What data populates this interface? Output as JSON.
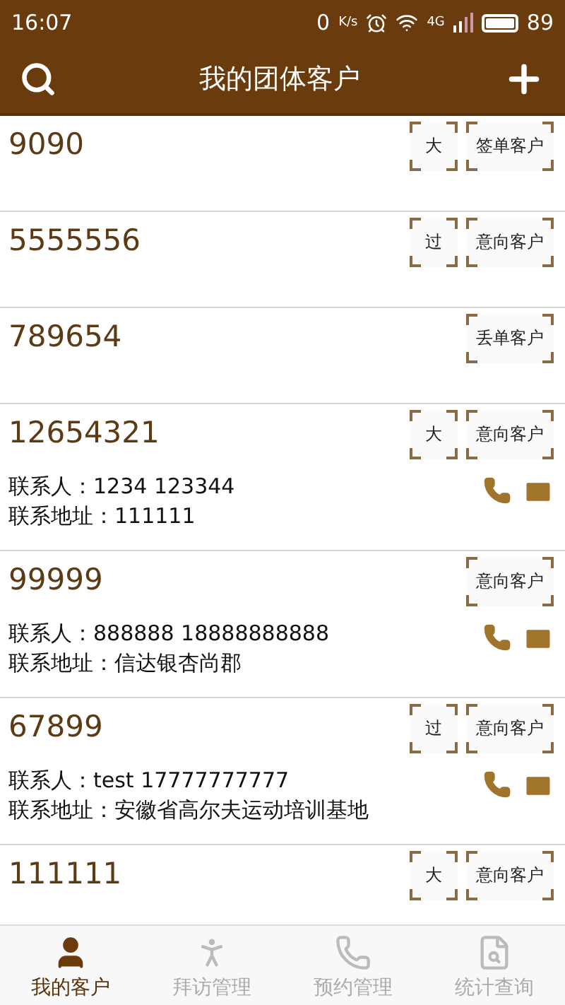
{
  "status_bar": {
    "time": "16:07",
    "speed": "0",
    "speed_unit": "K/s",
    "network": "4G",
    "battery": "89"
  },
  "header": {
    "title": "我的团体客户"
  },
  "customers": [
    {
      "name": "9090",
      "tags": [
        "大",
        "签单客户"
      ]
    },
    {
      "name": "5555556",
      "tags": [
        "过",
        "意向客户"
      ]
    },
    {
      "name": "789654",
      "tags": [
        "丢单客户"
      ]
    },
    {
      "name": "12654321",
      "tags": [
        "大",
        "意向客户"
      ],
      "contact": "联系人：1234  123344",
      "address": "联系地址：111111"
    },
    {
      "name": "99999",
      "tags": [
        "意向客户"
      ],
      "contact": "联系人：888888  18888888888",
      "address": "联系地址：信达银杏尚郡"
    },
    {
      "name": "67899",
      "tags": [
        "过",
        "意向客户"
      ],
      "contact": "联系人：test  17777777777",
      "address": "联系地址：安徽省高尔夫运动培训基地"
    },
    {
      "name": "111111",
      "tags": [
        "大",
        "意向客户"
      ]
    }
  ],
  "tab_bar": [
    {
      "label": "我的客户",
      "kind": "user",
      "selected": true
    },
    {
      "label": "拜访管理",
      "kind": "visit",
      "selected": false
    },
    {
      "label": "预约管理",
      "kind": "phone",
      "selected": false
    },
    {
      "label": "统计查询",
      "kind": "report",
      "selected": false
    }
  ]
}
